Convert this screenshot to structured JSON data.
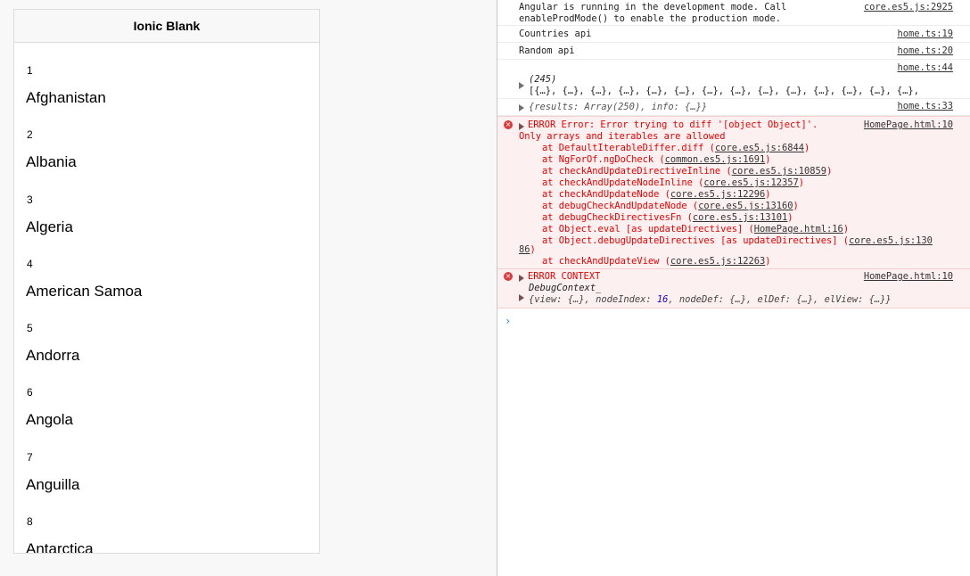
{
  "app": {
    "title": "Ionic Blank",
    "countries": [
      {
        "index": "1",
        "name": "Afghanistan"
      },
      {
        "index": "2",
        "name": "Albania"
      },
      {
        "index": "3",
        "name": "Algeria"
      },
      {
        "index": "4",
        "name": "American Samoa"
      },
      {
        "index": "5",
        "name": "Andorra"
      },
      {
        "index": "6",
        "name": "Angola"
      },
      {
        "index": "7",
        "name": "Anguilla"
      },
      {
        "index": "8",
        "name": "Antarctica"
      }
    ]
  },
  "console": {
    "angular_msg_line1": "Angular is running in the development mode. Call",
    "angular_msg_line2": "enableProdMode() to enable the production mode.",
    "angular_src": "core.es5.js:2925",
    "countries_api": "Countries api",
    "countries_src": "home.ts:19",
    "random_api": "Random api",
    "random_src": "home.ts:20",
    "array_src": "home.ts:44",
    "array_count": "(245)",
    "array_preview": "[{…}, {…}, {…}, {…}, {…}, {…}, {…}, {…}, {…}, {…}, {…}, {…}, {…}, {…},",
    "results_text": "{results: Array(250), info: {…}}",
    "results_src": "home.ts:33",
    "error1": {
      "line1": "ERROR Error: Error trying to diff '[object Object]'.",
      "line2": "Only arrays and iterables are allowed",
      "src": "HomePage.html:10",
      "stack": [
        {
          "fn": "at DefaultIterableDiffer.diff (",
          "file": "core.es5.js:6844",
          "end": ")"
        },
        {
          "fn": "at NgForOf.ngDoCheck (",
          "file": "common.es5.js:1691",
          "end": ")"
        },
        {
          "fn": "at checkAndUpdateDirectiveInline (",
          "file": "core.es5.js:10859",
          "end": ")"
        },
        {
          "fn": "at checkAndUpdateNodeInline (",
          "file": "core.es5.js:12357",
          "end": ")"
        },
        {
          "fn": "at checkAndUpdateNode (",
          "file": "core.es5.js:12296",
          "end": ")"
        },
        {
          "fn": "at debugCheckAndUpdateNode (",
          "file": "core.es5.js:13160",
          "end": ")"
        },
        {
          "fn": "at debugCheckDirectivesFn (",
          "file": "core.es5.js:13101",
          "end": ")"
        },
        {
          "fn": "at Object.eval [as updateDirectives] (",
          "file": "HomePage.html:16",
          "end": ")"
        },
        {
          "fn": "at Object.debugUpdateDirectives [as updateDirectives] (",
          "file": "core.es5.js:130",
          "end": ""
        }
      ],
      "wrap_tail": "86",
      "wrap_end": ")",
      "last_stack_fn": "at checkAndUpdateView (",
      "last_stack_file": "core.es5.js:12263",
      "last_stack_end": ")"
    },
    "error2": {
      "line1": "ERROR CONTEXT",
      "src": "HomePage.html:10",
      "context_name": "DebugContext_",
      "context_pre": "{view: {…}, nodeIndex: ",
      "context_num": "16",
      "context_post": ", nodeDef: {…}, elDef: {…}, elView: {…}}"
    },
    "prompt_symbol": "›",
    "error_icon": "x-circle-icon",
    "colors": {
      "error_text": "#e60000",
      "error_bg": "#fdf0f0",
      "prompt": "#2d7ff9",
      "number": "#1c00cf"
    }
  }
}
